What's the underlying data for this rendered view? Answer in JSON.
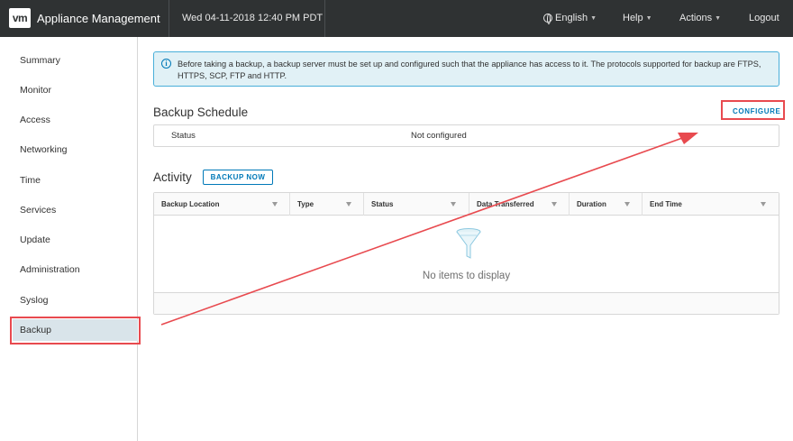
{
  "header": {
    "logo": "vm",
    "app_title": "Appliance Management",
    "datetime": "Wed 04-11-2018 12:40 PM PDT",
    "language": "English",
    "help": "Help",
    "actions": "Actions",
    "logout": "Logout"
  },
  "sidebar": {
    "items": [
      {
        "label": "Summary"
      },
      {
        "label": "Monitor"
      },
      {
        "label": "Access"
      },
      {
        "label": "Networking"
      },
      {
        "label": "Time"
      },
      {
        "label": "Services"
      },
      {
        "label": "Update"
      },
      {
        "label": "Administration"
      },
      {
        "label": "Syslog"
      },
      {
        "label": "Backup"
      }
    ],
    "active": "Backup"
  },
  "info_banner": {
    "icon": "info-icon",
    "text": "Before taking a backup, a backup server must be set up and configured such that the appliance has access to it. The protocols supported for backup are FTPS, HTTPS, SCP, FTP and HTTP."
  },
  "backup_schedule": {
    "title": "Backup Schedule",
    "configure_label": "CONFIGURE",
    "status_label": "Status",
    "status_value": "Not configured"
  },
  "activity": {
    "title": "Activity",
    "backup_now_label": "BACKUP NOW",
    "columns": [
      "Backup Location",
      "Type",
      "Status",
      "Data Transferred",
      "Duration",
      "End Time"
    ],
    "empty_text": "No items to display"
  },
  "annotation_color": "#e84a4f"
}
